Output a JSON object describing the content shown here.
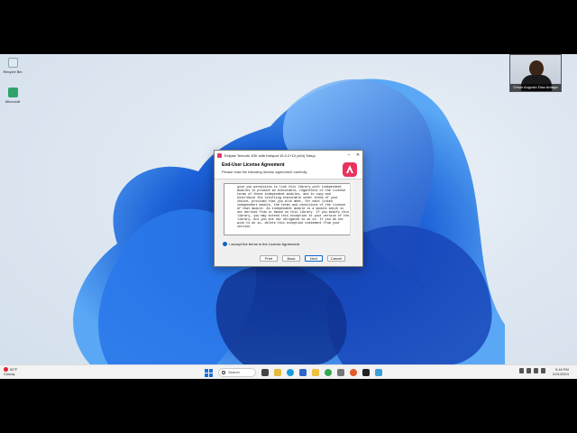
{
  "desktop": {
    "icons": [
      {
        "label": "Recycle Bin",
        "color": "#dfe9f2"
      },
      {
        "label": "Microsoft",
        "color": "#2fa36b"
      }
    ]
  },
  "webcam": {
    "name": "Cesar Augusto Diaz Arriaga"
  },
  "installer": {
    "title": "Eclipse Temurin JDK with Hotspot 15.0.2+10 (x64) Setup",
    "heading": "End-User License Agreement",
    "subheading": "Please read the following license agreement carefully",
    "license_text": "give you permission to link this library with independent\nmodules to produce an executable, regardless of the license\nterms of these independent modules, and to copy and\ndistribute the resulting executable under terms of your\nchoice, provided that you also meet, for each linked\nindependent module, the terms and conditions of the license\nof that module. An independent module is a module which is\nnot derived from or based on this library. If you modify this\nlibrary, you may extend this exception to your version of the\nlibrary, but you are not obligated to do so. If you do not\nwish to do so, delete this exception statement from your\nversion.",
    "accept_label": "I accept the terms in the License Agreement",
    "buttons": {
      "print": "Print",
      "back": "Back",
      "next": "Next",
      "cancel": "Cancel"
    }
  },
  "taskbar": {
    "weather_temp": "52°F",
    "weather_desc": "Cloudy",
    "search_label": "Search",
    "time": "9:16 PM",
    "date": "2/21/2024"
  },
  "colors": {
    "accent": "#0a64c8",
    "brand": "#e8335f"
  }
}
